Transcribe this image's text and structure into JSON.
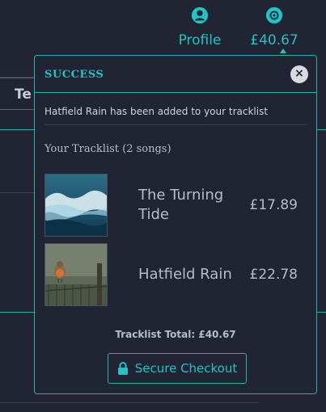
{
  "header": {
    "profile_label": "Profile",
    "cart_label": "£40.67",
    "profile_icon": "user-circle-icon",
    "cart_icon": "disc-icon"
  },
  "background": {
    "tab_fragment": "Te"
  },
  "popup": {
    "title": "SUCCESS",
    "close_glyph": "×",
    "message": "Hatfield Rain has been added to your tracklist",
    "tracklist_title": "Your Tracklist (2 songs)",
    "tracks": [
      {
        "name": "The Turning Tide",
        "price": "£17.89",
        "art": "wave-artwork"
      },
      {
        "name": "Hatfield Rain",
        "price": "£22.78",
        "art": "robin-artwork"
      }
    ],
    "total": "Tracklist Total: £40.67",
    "checkout_label": "Secure Checkout",
    "checkout_icon": "lock-icon"
  },
  "colors": {
    "background": "#202433",
    "accent": "#21c4c4",
    "text": "#d0d4dc",
    "muted_text": "#b9bcc4"
  }
}
